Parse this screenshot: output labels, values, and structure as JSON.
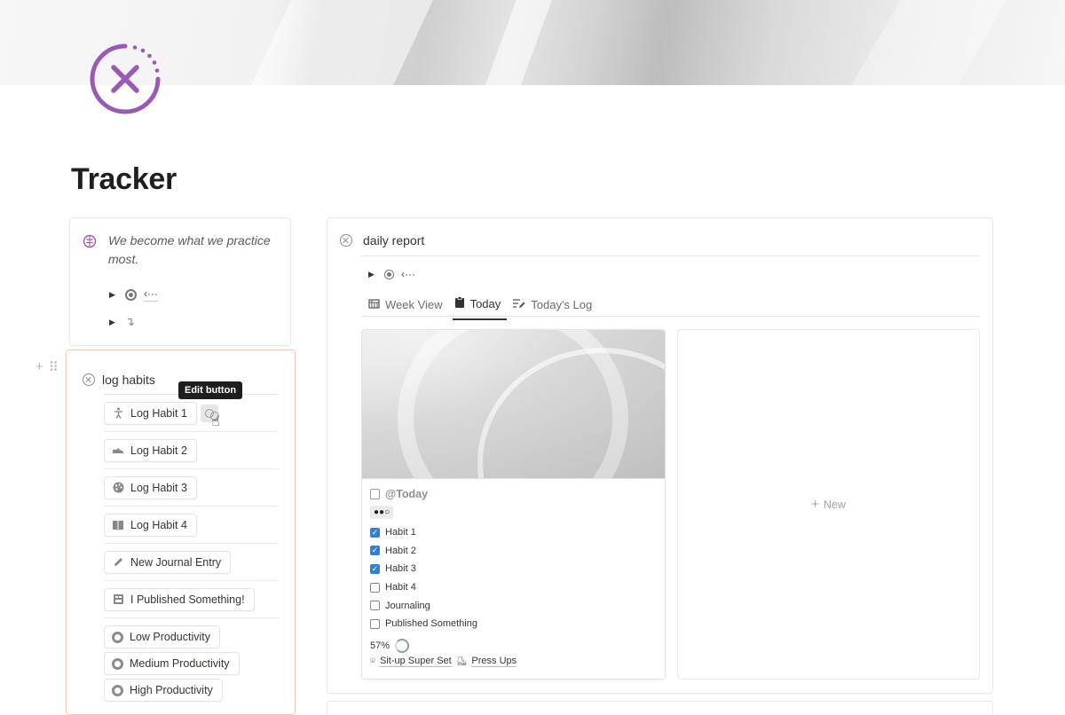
{
  "page": {
    "title": "Tracker",
    "accent_color": "#9b59b6",
    "icon": "x-circle-dotted-icon"
  },
  "quote_block": {
    "icon": "brain-icon",
    "text": "We become what we practice most.",
    "toggle1_icon": "target-circle-icon",
    "toggle1_text": "‹···",
    "toggle2_text": "↴"
  },
  "log_habits": {
    "title": "log habits",
    "tooltip": "Edit button",
    "buttons": [
      {
        "label": "Log Habit 1",
        "icon": "person-icon"
      },
      {
        "label": "Log Habit 2",
        "icon": "sneaker-icon"
      },
      {
        "label": "Log Habit 3",
        "icon": "palette-icon"
      },
      {
        "label": "Log Habit 4",
        "icon": "book-icon"
      },
      {
        "label": "New Journal Entry",
        "icon": "pencil-icon"
      },
      {
        "label": "I Published Something!",
        "icon": "clapperboard-icon"
      }
    ],
    "productivity_buttons": [
      {
        "label": "Low Productivity",
        "icon": "circle-icon"
      },
      {
        "label": "Medium Productivity",
        "icon": "circle-icon"
      },
      {
        "label": "High Productivity",
        "icon": "circle-icon"
      }
    ]
  },
  "daily_report": {
    "title": "daily report",
    "sub_toggle_text": "‹···",
    "tabs": [
      {
        "label": "Week View",
        "icon": "calendar-icon",
        "active": false
      },
      {
        "label": "Today",
        "icon": "clipboard-icon",
        "active": true
      },
      {
        "label": "Today's Log",
        "icon": "list-edit-icon",
        "active": false
      }
    ],
    "card": {
      "date": "@Today",
      "dots": "●●○",
      "checklist": [
        {
          "label": "Habit 1",
          "checked": true
        },
        {
          "label": "Habit 2",
          "checked": true
        },
        {
          "label": "Habit 3",
          "checked": true
        },
        {
          "label": "Habit 4",
          "checked": false
        },
        {
          "label": "Journaling",
          "checked": false
        },
        {
          "label": "Published Something",
          "checked": false
        }
      ],
      "progress_text": "57%",
      "progress_value": 0.57,
      "relations": [
        "Sit-up Super Set",
        "Press Ups"
      ]
    },
    "new_label": "New"
  }
}
